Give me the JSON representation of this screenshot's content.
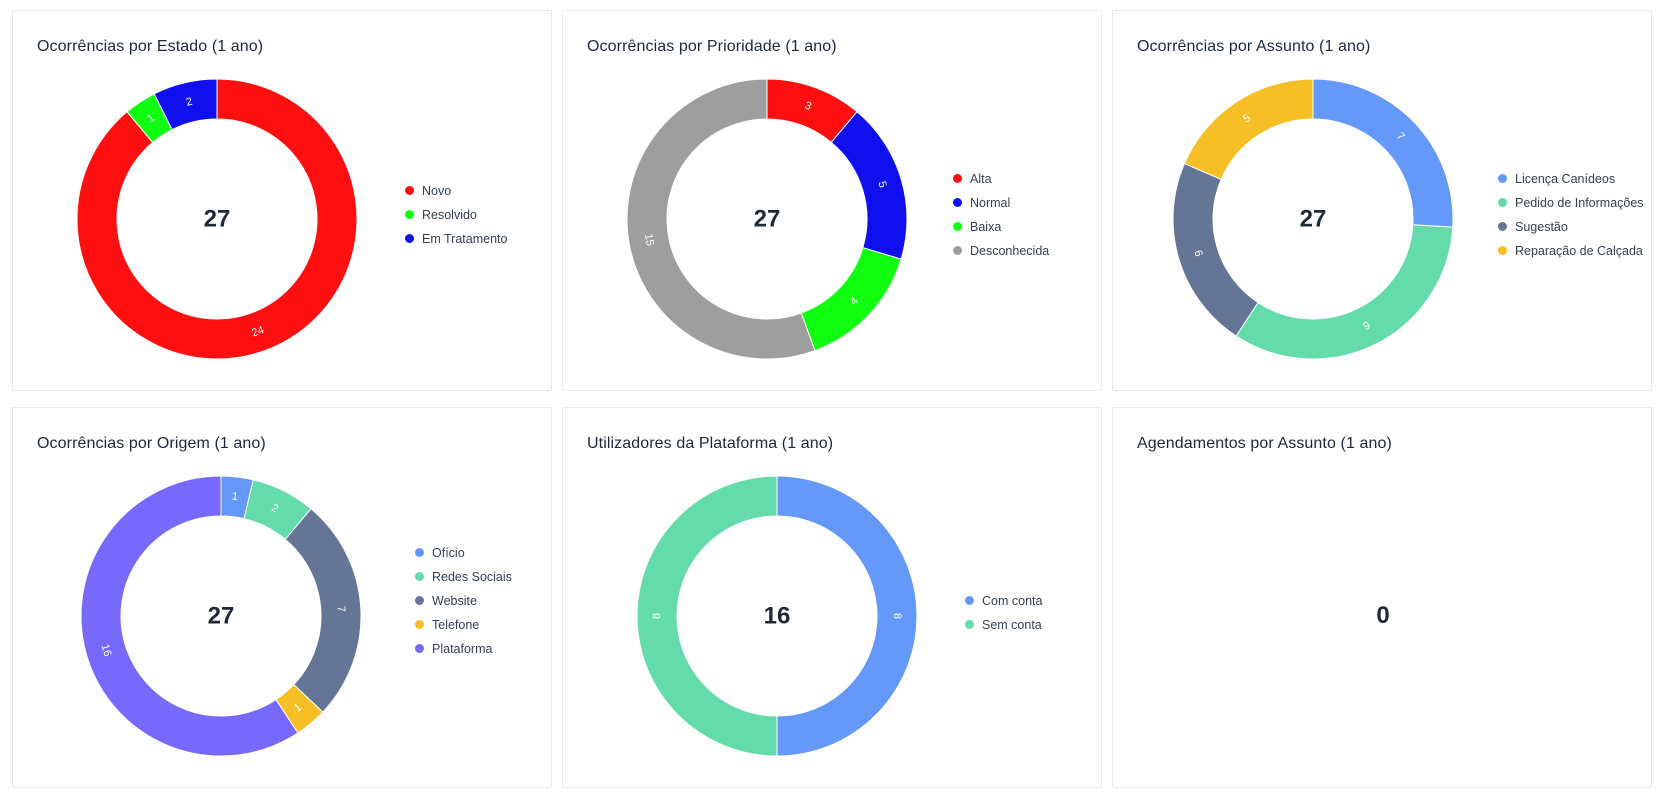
{
  "charts": [
    {
      "title": "Ocorrências por Estado (1 ano)",
      "total": "27",
      "chart_data": {
        "type": "pie",
        "title": "Ocorrências por Estado (1 ano)",
        "categories": [
          "Novo",
          "Resolvido",
          "Em Tratamento"
        ],
        "values": [
          24,
          1,
          2
        ],
        "colors": [
          "#ff0f0f",
          "#11ff11",
          "#1010ee"
        ],
        "legend_position": "right"
      }
    },
    {
      "title": "Ocorrências por Prioridade (1 ano)",
      "total": "27",
      "chart_data": {
        "type": "pie",
        "title": "Ocorrências por Prioridade (1 ano)",
        "categories": [
          "Alta",
          "Normal",
          "Baixa",
          "Desconhecida"
        ],
        "values": [
          3,
          5,
          4,
          15
        ],
        "colors": [
          "#ff0f0f",
          "#1010ee",
          "#11ff11",
          "#9e9e9e"
        ],
        "legend_position": "right"
      }
    },
    {
      "title": "Ocorrências por Assunto (1 ano)",
      "total": "27",
      "chart_data": {
        "type": "pie",
        "title": "Ocorrências por Assunto (1 ano)",
        "categories": [
          "Licença Canídeos",
          "Pedido de Informações",
          "Sugestão",
          "Reparação de Calçada"
        ],
        "values": [
          7,
          9,
          6,
          5
        ],
        "colors": [
          "#6599f9",
          "#63dbab",
          "#647595",
          "#f6bf26"
        ],
        "legend_position": "right"
      }
    },
    {
      "title": "Ocorrências por Origem (1 ano)",
      "total": "27",
      "chart_data": {
        "type": "pie",
        "title": "Ocorrências por Origem (1 ano)",
        "categories": [
          "Ofício",
          "Redes Sociais",
          "Website",
          "Telefone",
          "Plataforma"
        ],
        "values": [
          1,
          2,
          7,
          1,
          16
        ],
        "colors": [
          "#6599f9",
          "#63dbab",
          "#647595",
          "#f6bf26",
          "#7769fb"
        ],
        "legend_position": "right"
      }
    },
    {
      "title": "Utilizadores da Plataforma (1 ano)",
      "total": "16",
      "chart_data": {
        "type": "pie",
        "title": "Utilizadores da Plataforma (1 ano)",
        "categories": [
          "Com conta",
          "Sem conta"
        ],
        "values": [
          8,
          8
        ],
        "colors": [
          "#6599f9",
          "#63dbab"
        ],
        "legend_position": "right"
      }
    },
    {
      "title": "Agendamentos por Assunto (1 ano)",
      "total": "0",
      "chart_data": {
        "type": "pie",
        "title": "Agendamentos por Assunto (1 ano)",
        "categories": [],
        "values": [],
        "colors": []
      }
    }
  ]
}
